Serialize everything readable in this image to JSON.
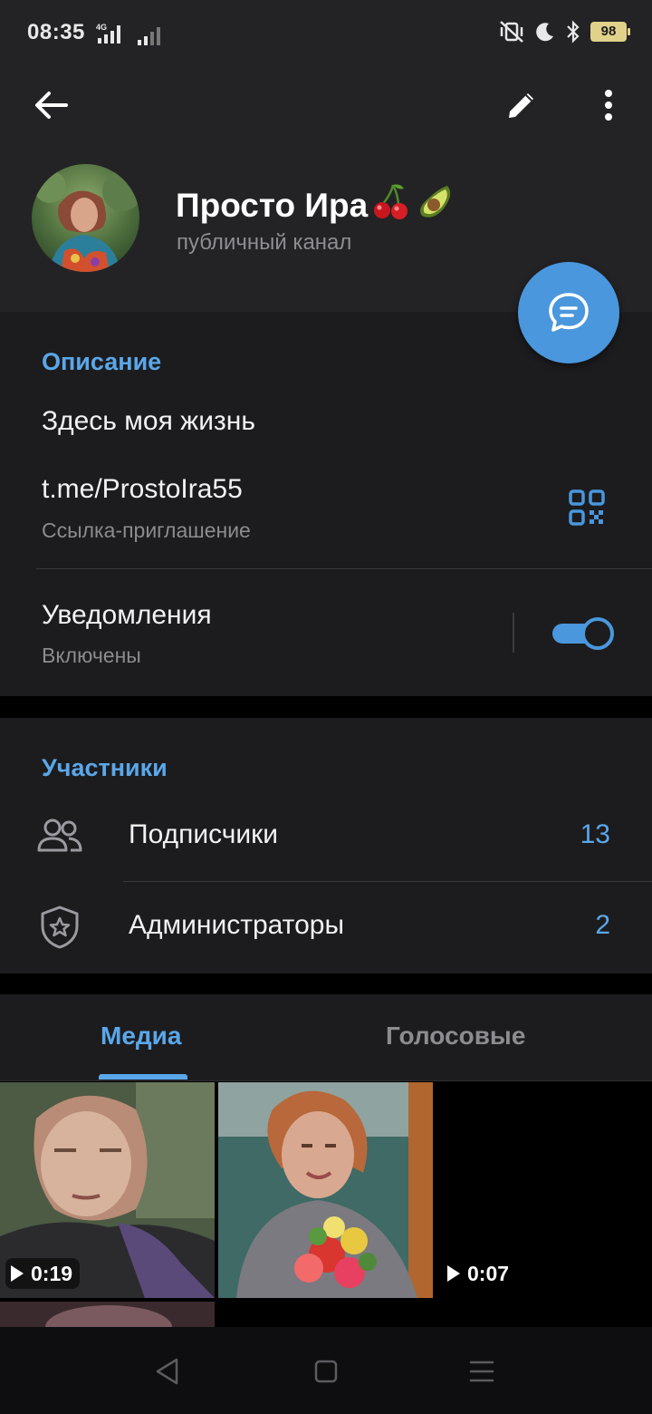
{
  "status_bar": {
    "time": "08:35",
    "network": "4G",
    "battery": "98"
  },
  "header": {
    "channel_name": "Просто Ира",
    "channel_emoji": [
      "cherries-emoji",
      "avocado-emoji"
    ],
    "channel_type": "публичный канал"
  },
  "info": {
    "description_title": "Описание",
    "description_text": "Здесь моя жизнь",
    "link": "t.me/ProstoIra55",
    "link_caption": "Ссылка-приглашение",
    "notifications_label": "Уведомления",
    "notifications_state": "Включены",
    "notifications_on": true
  },
  "members": {
    "title": "Участники",
    "items": [
      {
        "label": "Подписчики",
        "count": "13"
      },
      {
        "label": "Администраторы",
        "count": "2"
      }
    ]
  },
  "tabs": [
    {
      "label": "Медиа",
      "active": true
    },
    {
      "label": "Голосовые",
      "active": false
    }
  ],
  "media": [
    {
      "duration": "0:19"
    },
    {
      "duration": ""
    },
    {
      "duration": "0:07"
    }
  ],
  "colors": {
    "accent": "#4a97dd",
    "link_text": "#5aa7ea",
    "header_bg": "#232325",
    "section_bg": "#1c1c1e"
  }
}
